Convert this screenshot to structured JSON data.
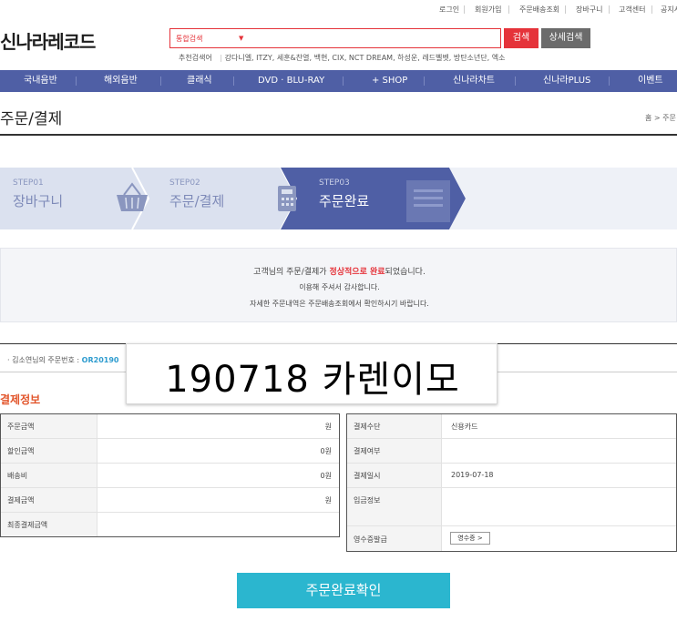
{
  "top_links": [
    "로그인",
    "회원가입",
    "주문배송조회",
    "장바구니",
    "고객센터",
    "공지사항"
  ],
  "header": {
    "logo": "신나라레코드",
    "search_scope": "통합검색",
    "search_button": "검색",
    "advanced_search_button": "상세검색",
    "recommended_title": "추천검색어",
    "recommended_keywords": "강다니엘, ITZY, 세훈&찬열, 백현, CIX, NCT DREAM, 하성운, 레드벨벳, 방탄소년단, 엑소"
  },
  "nav": [
    "국내음반",
    "해외음반",
    "클래식",
    "DVD · BLU-RAY",
    "+ SHOP",
    "신나라차트",
    "신나라PLUS",
    "이벤트"
  ],
  "page": {
    "title": "주문/결제",
    "breadcrumb": "홈 > 주문"
  },
  "steps": [
    {
      "num": "STEP01",
      "name": "장바구니"
    },
    {
      "num": "STEP02",
      "name": "주문/결제"
    },
    {
      "num": "STEP03",
      "name": "주문완료"
    }
  ],
  "message": {
    "line1_pre": "고객님의 주문/결제가 ",
    "line1_highlight": "정상적으로 완료",
    "line1_post": "되었습니다.",
    "line2": "이용해 주셔서 감사합니다.",
    "line3": "자세한 주문내역은 주문배송조회에서 확인하시기 바랍니다."
  },
  "order": {
    "prefix": "김소연님의 주문번호 : ",
    "number": "OR20190",
    "sticker": "190718 카렌이모"
  },
  "payment": {
    "section_title": "결제정보",
    "left": [
      {
        "label": "주문금액",
        "value": "원"
      },
      {
        "label": "할인금액",
        "value": "0원"
      },
      {
        "label": "배송비",
        "value": "0원"
      },
      {
        "label": "결제금액",
        "value": "원"
      },
      {
        "label": "최종결제금액",
        "value": ""
      }
    ],
    "right": [
      {
        "label": "결제수단",
        "value": "신용카드"
      },
      {
        "label": "결제여부",
        "value": ""
      },
      {
        "label": "결제일시",
        "value": "2019-07-18"
      },
      {
        "label": "입금정보",
        "value": ""
      },
      {
        "label": "영수증발급",
        "value": ""
      }
    ],
    "receipt_button": "영수증 >"
  },
  "confirm_button": "주문완료확인"
}
